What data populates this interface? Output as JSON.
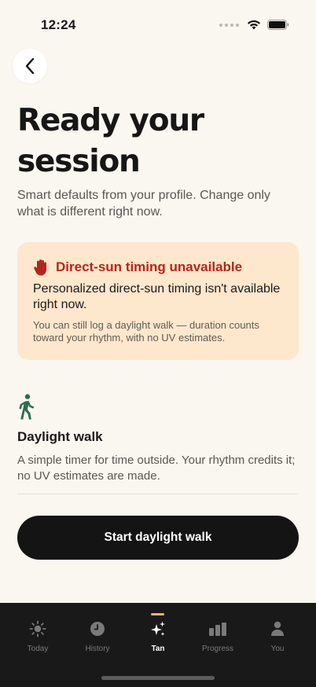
{
  "status_bar": {
    "time": "12:24"
  },
  "header": {
    "title": "Ready your session",
    "subtitle": "Smart defaults from your profile. Change only what is different right now."
  },
  "alert": {
    "title": "Direct-sun timing unavailable",
    "body": "Personalized direct-sun timing isn't available right now.",
    "note": "You can still log a daylight walk — duration counts toward your rhythm, with no UV estimates.",
    "colors": {
      "background": "#fde7cd",
      "title": "#b3261e",
      "icon": "#b3261e"
    }
  },
  "session": {
    "icon": "walking-person-icon",
    "title": "Daylight walk",
    "description": "A simple timer for time outside. Your rhythm credits it; no UV estimates are made."
  },
  "primary_action": {
    "label": "Start daylight walk"
  },
  "tabbar": {
    "active_tab": "Tan",
    "items": [
      {
        "label": "Today",
        "icon": "sun-icon"
      },
      {
        "label": "History",
        "icon": "clock-icon"
      },
      {
        "label": "Tan",
        "icon": "sparkles-icon"
      },
      {
        "label": "Progress",
        "icon": "bar-chart-icon"
      },
      {
        "label": "You",
        "icon": "person-icon"
      }
    ],
    "colors": {
      "background": "#191919",
      "active": "#ffffff",
      "inactive": "#7a7a7a",
      "indicator": "#e8b56b"
    }
  },
  "colors": {
    "page_background": "#faf6f0",
    "button": "#141414",
    "walk_icon": "#2f6b4f"
  }
}
